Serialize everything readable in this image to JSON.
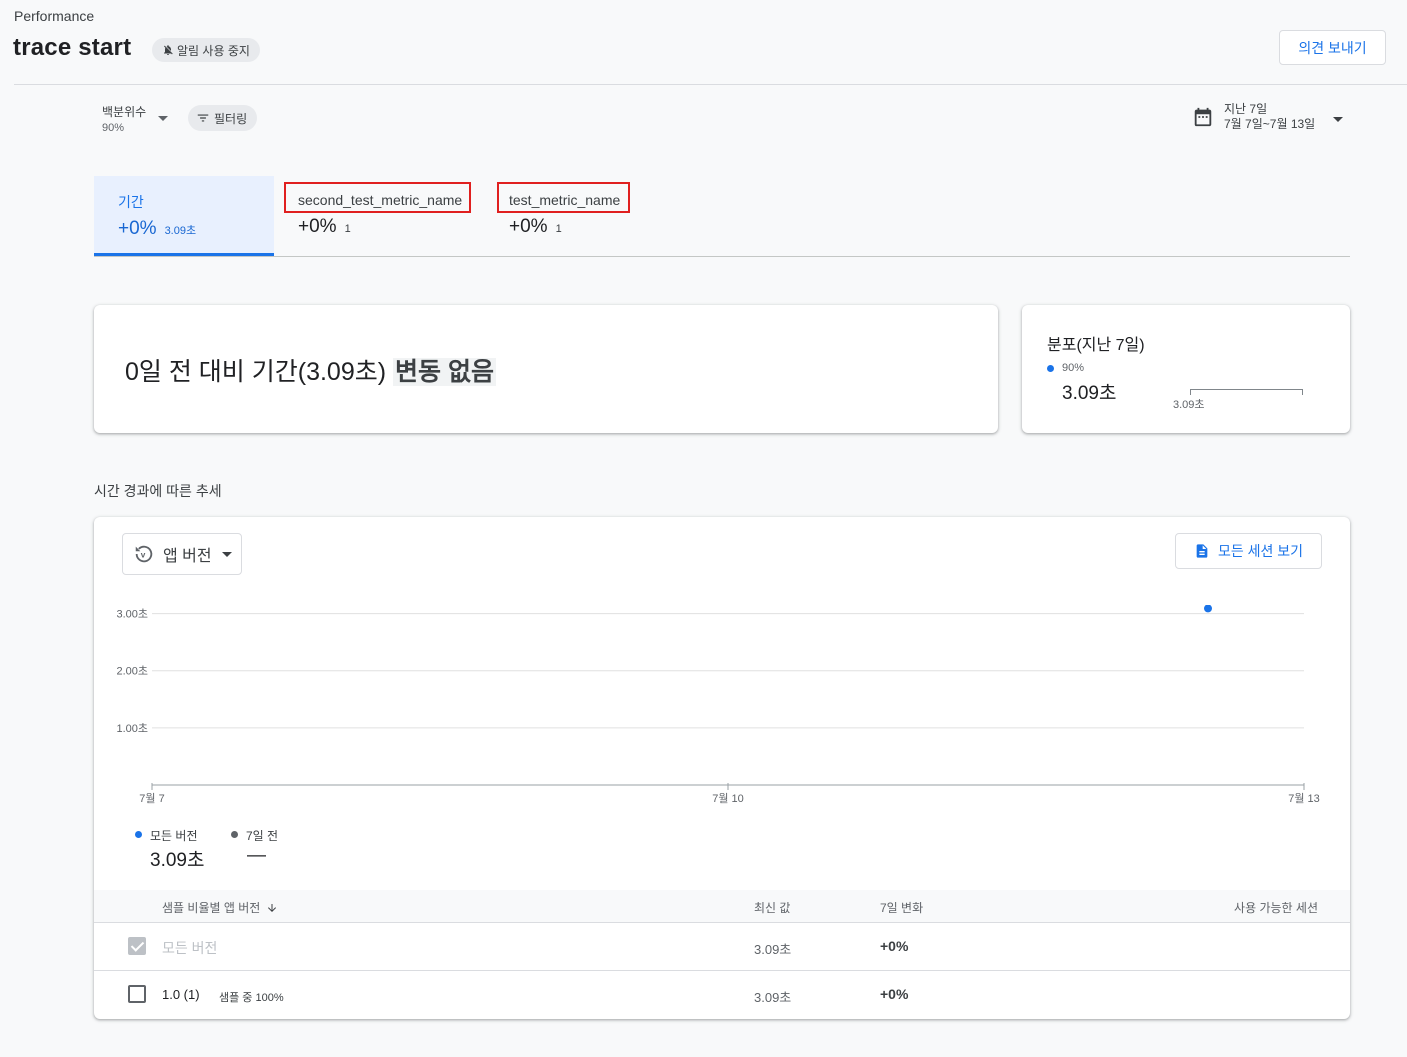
{
  "header": {
    "breadcrumb": "Performance",
    "title": "trace start",
    "alert_chip": "알림 사용 중지",
    "feedback_button": "의견 보내기"
  },
  "filters": {
    "percentile_label": "백분위수",
    "percentile_value": "90%",
    "filter_chip": "필터링",
    "date_range_label": "지난 7일",
    "date_range_value": "7월 7일~7월 13일"
  },
  "tabs": [
    {
      "name": "기간",
      "change": "+0%",
      "value": "3.09초",
      "active": true
    },
    {
      "name": "second_test_metric_name",
      "change": "+0%",
      "value": "1",
      "active": false
    },
    {
      "name": "test_metric_name",
      "change": "+0%",
      "value": "1",
      "active": false
    }
  ],
  "summary": {
    "text": "0일 전 대비 기간(3.09초)",
    "highlight": "변동 없음"
  },
  "distribution": {
    "title": "분포(지난 7일)",
    "percentile": "90%",
    "value": "3.09초",
    "tick": "3.09초"
  },
  "trend": {
    "heading": "시간 경과에 따른 추세",
    "version_select": "앱 버전",
    "sessions_button": "모든 세션 보기",
    "legend": [
      {
        "name": "모든 버전",
        "value": "3.09초",
        "color": "#1a73e8"
      },
      {
        "name": "7일 전",
        "value": "—",
        "color": "#5f6368"
      }
    ]
  },
  "chart_data": {
    "type": "scatter",
    "x_ticks": [
      "7월 7",
      "7월 10",
      "7월 13"
    ],
    "y_ticks": [
      "1.00초",
      "2.00초",
      "3.00초"
    ],
    "ylim": [
      0,
      3
    ],
    "xlim": [
      7,
      13
    ],
    "series": [
      {
        "name": "모든 버전",
        "points": [
          {
            "x": 12.5,
            "y": 3.09
          }
        ],
        "color": "#1a73e8"
      }
    ]
  },
  "table": {
    "headers": {
      "version": "샘플 비율별 앱 버전",
      "latest": "최신 값",
      "change": "7일 변화",
      "sessions": "사용 가능한 세션"
    },
    "rows": [
      {
        "name": "모든 버전",
        "sub": "",
        "latest": "3.09초",
        "change": "+0%",
        "checked": true,
        "disabled": true
      },
      {
        "name": "1.0 (1)",
        "sub": "샘플 중 100%",
        "latest": "3.09초",
        "change": "+0%",
        "checked": false,
        "disabled": false
      }
    ]
  }
}
